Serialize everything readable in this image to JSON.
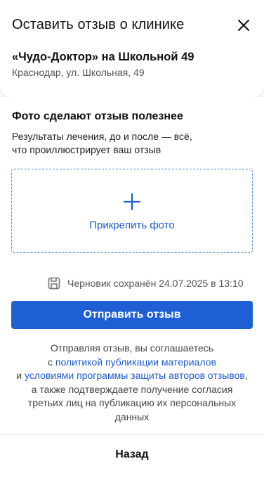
{
  "header": {
    "title": "Оставить отзыв о клинике",
    "close_icon": "close-icon",
    "clinic_name": "«Чудо-Доктор» на Школьной 49",
    "clinic_address": "Краснодар, ул. Школьная, 49"
  },
  "photo_section": {
    "title": "Фото сделают отзыв полезнее",
    "description_line1": "Результаты лечения, до и после — всё,",
    "description_line2": "что проиллюстрирует ваш отзыв",
    "upload_label": "Прикрепить фото",
    "upload_icon": "plus-icon"
  },
  "draft": {
    "icon": "save-icon",
    "text": "Черновик сохранён 24.07.2025 в 13:10"
  },
  "submit": {
    "label": "Отправить отзыв"
  },
  "consent": {
    "line1": "Отправляя отзыв, вы соглашаетесь",
    "prefix2": "с ",
    "link1": "политикой публикации материалов",
    "prefix3": "и ",
    "link2": "условиями программы защиты авторов отзывов",
    "rest": ", а также подтверждаете получение согласия третьих лиц на публикацию их персональных данных"
  },
  "footer": {
    "back_label": "Назад"
  },
  "colors": {
    "accent": "#1e5fd4",
    "link": "#1e5ccc",
    "dashed_border": "#4a87d9"
  }
}
